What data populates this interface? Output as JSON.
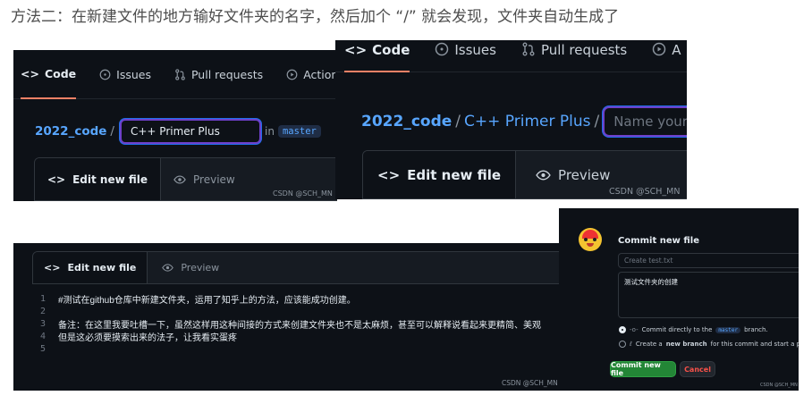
{
  "heading": "方法二：在新建文件的地方输好文件夹的名字，然后加个 “/” 就会发现，文件夹自动生成了",
  "shot1": {
    "tabs": [
      {
        "icon": "code-icon",
        "label": "Code"
      },
      {
        "icon": "issue-icon",
        "label": "Issues"
      },
      {
        "icon": "pull-request-icon",
        "label": "Pull requests"
      },
      {
        "icon": "play-icon",
        "label": "Actions"
      }
    ],
    "repo": "2022_code",
    "separator": "/",
    "filename_value": "C++ Primer Plus",
    "in_label": "in",
    "branch": "master",
    "edit_tab": "Edit new file",
    "preview_tab": "Preview",
    "watermark": "CSDN @SCH_MN"
  },
  "shot2": {
    "tabs": [
      {
        "icon": "code-icon",
        "label": "Code"
      },
      {
        "icon": "issue-icon",
        "label": "Issues"
      },
      {
        "icon": "pull-request-icon",
        "label": "Pull requests"
      },
      {
        "icon": "play-icon",
        "label": "A"
      }
    ],
    "repo": "2022_code",
    "folder": "C++ Primer Plus",
    "separator": "/",
    "filename_placeholder": "Name your file...",
    "edit_tab": "Edit new file",
    "preview_tab": "Preview",
    "watermark": "CSDN @SCH_MN"
  },
  "shot3": {
    "edit_tab": "Edit new file",
    "preview_tab": "Preview",
    "lines": [
      {
        "n": "1",
        "text": "#测试在github仓库中新建文件夹，运用了知乎上的方法，应该能成功创建。"
      },
      {
        "n": "2",
        "text": ""
      },
      {
        "n": "3",
        "text": "备注：在这里我要吐槽一下，虽然这样用这种间接的方式来创建文件夹也不是太麻烦，甚至可以解释说看起来更精简、美观"
      },
      {
        "n": "4",
        "text": "但是这必须要摸索出来的法子，让我看实蛋疼"
      },
      {
        "n": "5",
        "text": ""
      }
    ],
    "watermark": "CSDN @SCH_MN"
  },
  "shot4": {
    "title": "Commit new file",
    "summary_placeholder": "Create test.txt",
    "description_value": "测试文件夹的创建",
    "option1_prefix": "Commit directly to the",
    "option1_branch": "master",
    "option1_suffix": "branch.",
    "option2_prefix": "Create a",
    "option2_bold": "new branch",
    "option2_suffix": "for this commit and start a pu",
    "commit_button": "Commit new file",
    "cancel_button": "Cancel",
    "watermark": "CSDN @SCH_MN"
  }
}
